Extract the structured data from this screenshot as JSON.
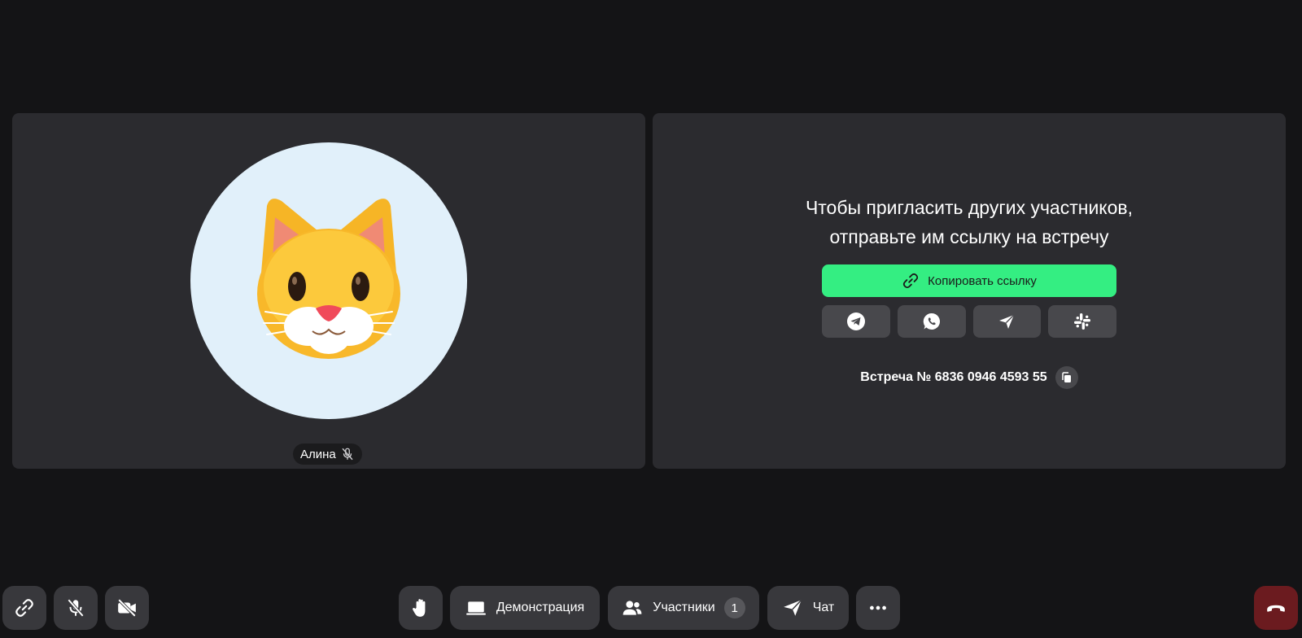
{
  "participant": {
    "name": "Алина",
    "avatar_icon": "cat-face-icon",
    "muted_icon": "mic-off-icon"
  },
  "invite_panel": {
    "message_line1": "Чтобы пригласить других участников,",
    "message_line2": "отправьте им ссылку на встречу",
    "copy_link_label": "Копировать ссылку",
    "share_buttons": [
      "telegram-icon",
      "whatsapp-icon",
      "send-icon",
      "slack-icon"
    ],
    "meeting_number": "Встреча № 6836 0946 4593 55"
  },
  "toolbar": {
    "screen_share_label": "Демонстрация",
    "participants_label": "Участники",
    "participants_count": "1",
    "chat_label": "Чат"
  },
  "colors": {
    "background": "#141416",
    "tile": "#2b2b2f",
    "accent_green": "#34ee82",
    "end_call": "#6b1b1f"
  }
}
